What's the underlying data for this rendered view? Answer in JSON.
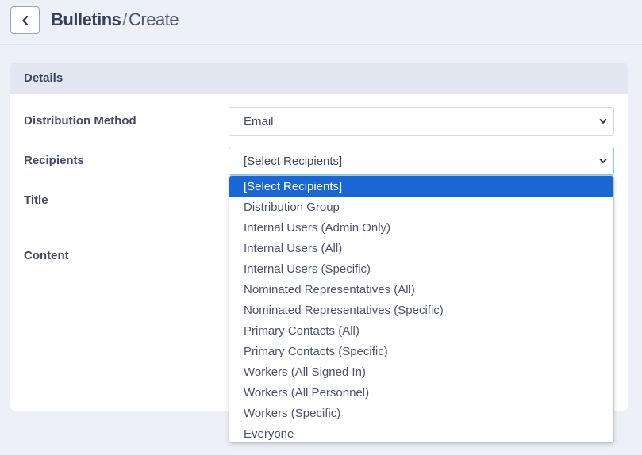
{
  "header": {
    "title": "Bulletins",
    "separator": "/",
    "subtitle": "Create",
    "back_icon": "chevron-left-icon"
  },
  "card": {
    "title": "Details",
    "fields": {
      "distribution_method": {
        "label": "Distribution Method",
        "value": "Email"
      },
      "recipients": {
        "label": "Recipients",
        "value": "[Select Recipients]"
      },
      "title": {
        "label": "Title"
      },
      "content": {
        "label": "Content"
      }
    }
  },
  "dropdown": {
    "selected_index": 0,
    "selected_color": "#1967d2",
    "options": [
      "[Select Recipients]",
      "Distribution Group",
      "Internal Users (Admin Only)",
      "Internal Users (All)",
      "Internal Users (Specific)",
      "Nominated Representatives (All)",
      "Nominated Representatives (Specific)",
      "Primary Contacts (All)",
      "Primary Contacts (Specific)",
      "Workers (All Signed In)",
      "Workers (All Personnel)",
      "Workers (Specific)",
      "Everyone"
    ]
  }
}
